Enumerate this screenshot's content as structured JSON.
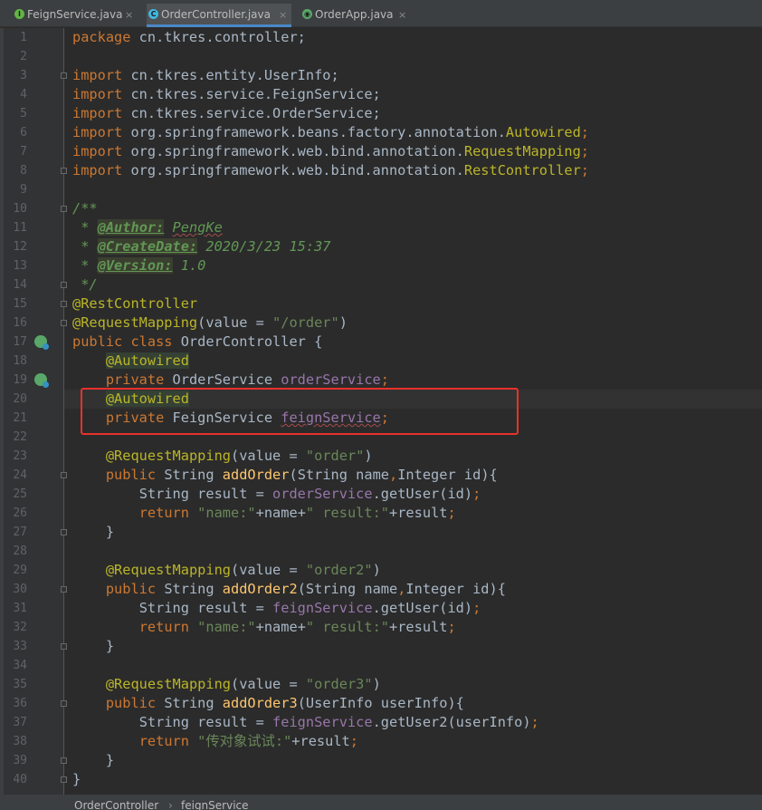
{
  "tabs": [
    {
      "label": "FeignService.java",
      "icon": "interface-icon",
      "active": false
    },
    {
      "label": "OrderController.java",
      "icon": "class-icon",
      "active": true
    },
    {
      "label": "OrderApp.java",
      "icon": "spring-app-icon",
      "active": false
    }
  ],
  "close_glyph": "×",
  "line_numbers": [
    "1",
    "2",
    "3",
    "4",
    "5",
    "6",
    "7",
    "8",
    "9",
    "10",
    "11",
    "12",
    "13",
    "14",
    "15",
    "16",
    "17",
    "18",
    "19",
    "20",
    "21",
    "22",
    "23",
    "24",
    "25",
    "26",
    "27",
    "28",
    "29",
    "30",
    "31",
    "32",
    "33",
    "34",
    "35",
    "36",
    "37",
    "38",
    "39",
    "40"
  ],
  "code": {
    "l1_kw": "package",
    "l1_rest": " cn.tkres.controller;",
    "l3_kw": "import",
    "l3_rest": " cn.tkres.entity.UserInfo;",
    "l4_kw": "import",
    "l4_rest": " cn.tkres.service.FeignService;",
    "l5_kw": "import",
    "l5_rest": " cn.tkres.service.OrderService;",
    "l6_kw": "import",
    "l6_rest": " org.springframework.beans.factory.annotation.",
    "l6_ann": "Autowired",
    "l6_semi": ";",
    "l7_kw": "import",
    "l7_rest": " org.springframework.web.bind.annotation.",
    "l7_ann": "RequestMapping",
    "l7_semi": ";",
    "l8_kw": "import",
    "l8_rest": " org.springframework.web.bind.annotation.",
    "l8_ann": "RestController",
    "l8_semi": ";",
    "l10": "/**",
    "l11_pre": " * ",
    "l11_tag": "@Author:",
    "l11_sp": " ",
    "l11_val": "PengKe",
    "l12_pre": " * ",
    "l12_tag": "@CreateDate:",
    "l12_val": " 2020/3/23 15:37",
    "l13_pre": " * ",
    "l13_tag": "@Version:",
    "l13_val": " 1.0",
    "l14": " */",
    "l15": "@RestController",
    "l16_ann": "@RequestMapping",
    "l16_a": "(value = ",
    "l16_str": "\"/order\"",
    "l16_b": ")",
    "l17_kw": "public class",
    "l17_rest": " OrderController {",
    "l18_ann": "@Autowired",
    "l19_kw": "private",
    "l19_type": " OrderService ",
    "l19_fld": "orderService",
    "l19_semi": ";",
    "l20_ann": "@Autowired",
    "l21_kw": "private",
    "l21_type": " FeignService ",
    "l21_fld": "feignService",
    "l21_semi": ";",
    "l23_ann": "@RequestMapping",
    "l23_a": "(value = ",
    "l23_str": "\"order\"",
    "l23_b": ")",
    "l24_kw": "public",
    "l24_a": " String ",
    "l24_fn": "addOrder",
    "l24_b": "(String name",
    "l24_c": ",",
    "l24_d": "Integer id){",
    "l25_a": "String result = ",
    "l25_fld": "orderService",
    "l25_b": ".getUser(id)",
    "l25_semi": ";",
    "l26_kw": "return",
    "l26_s1": " \"name:\"",
    "l26_a": "+name+",
    "l26_s2": "\" result:\"",
    "l26_b": "+result",
    "l26_semi": ";",
    "l27": "}",
    "l29_ann": "@RequestMapping",
    "l29_a": "(value = ",
    "l29_str": "\"order2\"",
    "l29_b": ")",
    "l30_kw": "public",
    "l30_a": " String ",
    "l30_fn": "addOrder2",
    "l30_b": "(String name",
    "l30_c": ",",
    "l30_d": "Integer id){",
    "l31_a": "String result = ",
    "l31_fld": "feignService",
    "l31_b": ".getUser(id)",
    "l31_semi": ";",
    "l32_kw": "return",
    "l32_s1": " \"name:\"",
    "l32_a": "+name+",
    "l32_s2": "\" result:\"",
    "l32_b": "+result",
    "l32_semi": ";",
    "l33": "}",
    "l35_ann": "@RequestMapping",
    "l35_a": "(value = ",
    "l35_str": "\"order3\"",
    "l35_b": ")",
    "l36_kw": "public",
    "l36_a": " String ",
    "l36_fn": "addOrder3",
    "l36_b": "(UserInfo userInfo){",
    "l37_a": "String result = ",
    "l37_fld": "feignService",
    "l37_b": ".getUser2(userInfo)",
    "l37_semi": ";",
    "l38_kw": "return",
    "l38_s1": " \"传对象试试:\"",
    "l38_b": "+result",
    "l38_semi": ";",
    "l39": "}",
    "l40": "}"
  },
  "breadcrumb": [
    "OrderController",
    "feignService"
  ],
  "breadcrumb_sep": "›",
  "colors": {
    "keyword": "#cc7832",
    "annotation": "#bbb529",
    "string": "#6a8759",
    "field": "#9876aa",
    "method": "#ffc66d",
    "doc_comment": "#629755",
    "highlight_box": "#e8312a",
    "background": "#2b2b2b"
  }
}
